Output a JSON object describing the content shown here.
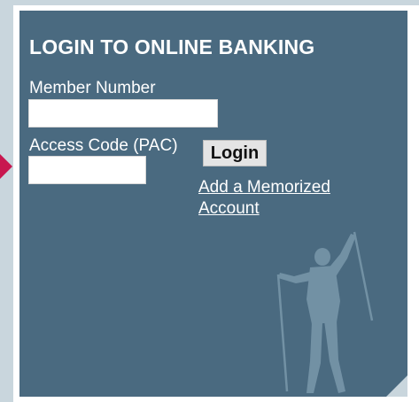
{
  "login_panel": {
    "title": "LOGIN TO ONLINE BANKING",
    "member_number_label": "Member Number",
    "member_number_value": "",
    "access_code_label": "Access Code (PAC)",
    "access_code_value": "",
    "login_button_label": "Login",
    "memorized_account_link": "Add a Memorized Account"
  },
  "colors": {
    "panel_background": "#4a6a80",
    "page_background": "#c9d6dd",
    "accent_arrow": "#c8174f"
  },
  "icons": {
    "pointer": "arrow-right-icon",
    "decoration": "skier-silhouette-icon"
  }
}
